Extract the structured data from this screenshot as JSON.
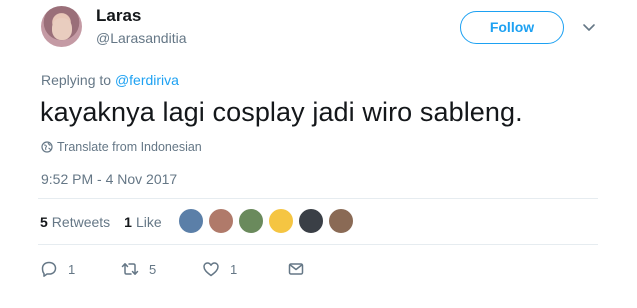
{
  "author": {
    "name": "Laras",
    "handle": "@Larasanditia"
  },
  "header": {
    "follow_label": "Follow"
  },
  "reply": {
    "prefix": "Replying to ",
    "mention": "@ferdiriva"
  },
  "tweet": {
    "text": "kayaknya lagi cosplay jadi wiro sableng.",
    "translate_label": "Translate from Indonesian",
    "timestamp": "9:52 PM - 4 Nov 2017"
  },
  "stats": {
    "retweets_count": "5",
    "retweets_label": "Retweets",
    "likes_count": "1",
    "likes_label": "Like"
  },
  "likers": [
    {
      "color": "#5b7fa8"
    },
    {
      "color": "#b07a6a"
    },
    {
      "color": "#6a8a5c"
    },
    {
      "color": "#f5c542"
    },
    {
      "color": "#3a3f46"
    },
    {
      "color": "#8a6a55"
    }
  ],
  "actions": {
    "reply_count": "1",
    "retweet_count": "5",
    "like_count": "1"
  },
  "colors": {
    "accent": "#1da1f2",
    "muted": "#657786",
    "text": "#14171a"
  }
}
